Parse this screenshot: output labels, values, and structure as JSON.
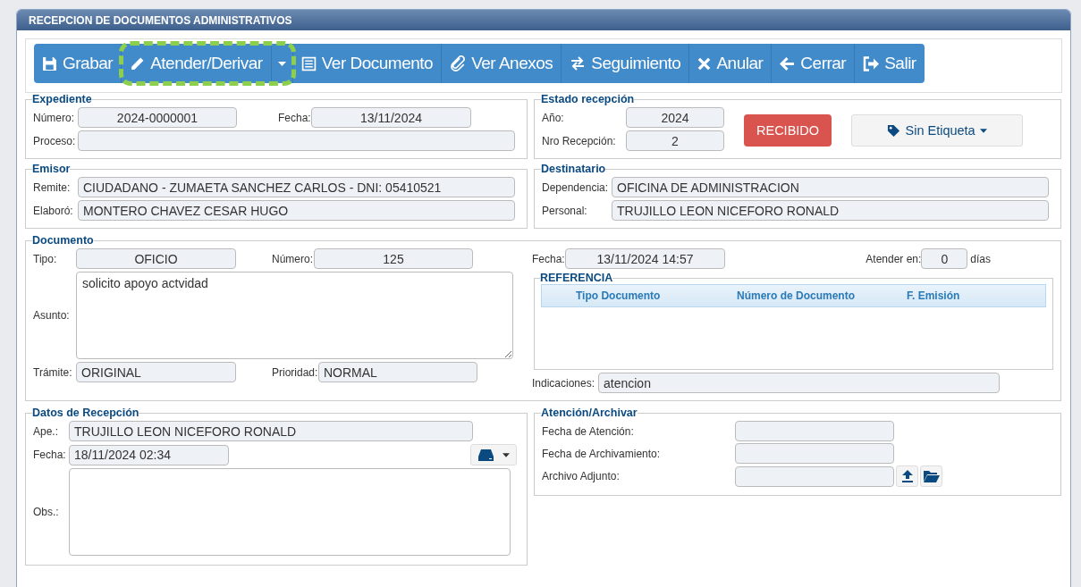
{
  "window": {
    "title": "RECEPCION DE DOCUMENTOS ADMINISTRATIVOS"
  },
  "toolbar": [
    {
      "kind": "button",
      "label": "Grabar",
      "highlighted": false
    },
    {
      "kind": "split",
      "label": "Atender/Derivar",
      "highlighted": true
    },
    {
      "kind": "button",
      "label": "Ver Documento",
      "highlighted": false
    },
    {
      "kind": "button",
      "label": "Ver Anexos",
      "highlighted": false
    },
    {
      "kind": "button",
      "label": "Seguimiento",
      "highlighted": false
    },
    {
      "kind": "button",
      "label": "Anular",
      "highlighted": false
    },
    {
      "kind": "button",
      "label": "Cerrar",
      "highlighted": false
    },
    {
      "kind": "button",
      "label": "Salir",
      "highlighted": false
    }
  ],
  "expediente": {
    "legend": "Expediente",
    "numero": {
      "label": "Número:",
      "value": "2024-0000001"
    },
    "fecha": {
      "label": "Fecha:",
      "value": "13/11/2024"
    },
    "proceso": {
      "label": "Proceso:"
    }
  },
  "estado": {
    "legend": "Estado recepción",
    "anio": {
      "label": "Año:",
      "value": "2024"
    },
    "nro": {
      "label": "Nro Recepción:",
      "value": "2"
    },
    "status": "RECIBIDO",
    "etiqueta": "Sin Etiqueta"
  },
  "emisor": {
    "legend": "Emisor",
    "remite": {
      "label": "Remite:",
      "value": "CIUDADANO - ZUMAETA SANCHEZ CARLOS - DNI: 05410521"
    },
    "elaboro": {
      "label": "Elaboró:",
      "value": "MONTERO CHAVEZ CESAR HUGO"
    }
  },
  "destinatario": {
    "legend": "Destinatario",
    "dependencia": {
      "label": "Dependencia:",
      "value": "OFICINA DE ADMINISTRACION"
    },
    "personal": {
      "label": "Personal:",
      "value": "TRUJILLO LEON NICEFORO RONALD"
    }
  },
  "documento": {
    "legend": "Documento",
    "tipo": {
      "label": "Tipo:",
      "value": "OFICIO"
    },
    "numero": {
      "label": "Número:",
      "value": "125"
    },
    "fecha": {
      "label": "Fecha:",
      "value": "13/11/2024 14:57"
    },
    "atender_en": {
      "label": "Atender en:",
      "value": "0",
      "unit": "días"
    },
    "asunto": {
      "label": "Asunto:",
      "value": "solicito apoyo actvidad"
    },
    "tramite": {
      "label": "Trámite:",
      "value": "ORIGINAL"
    },
    "prioridad": {
      "label": "Prioridad:",
      "value": "NORMAL"
    },
    "indicaciones": {
      "label": "Indicaciones:",
      "value": "atencion"
    },
    "referencia": {
      "legend": "REFERENCIA",
      "columns": [
        "Tipo Documento",
        "Número de Documento",
        "F. Emisión"
      ]
    }
  },
  "recepcion": {
    "legend": "Datos de Recepción",
    "ape": {
      "label": "Ape.:",
      "value": "TRUJILLO LEON NICEFORO RONALD"
    },
    "fecha": {
      "label": "Fecha:",
      "value": "18/11/2024 02:34"
    },
    "obs": {
      "label": "Obs.:"
    }
  },
  "atencion": {
    "legend": "Atención/Archivar",
    "fecha_atencion": {
      "label": "Fecha de Atención:"
    },
    "fecha_archivamiento": {
      "label": "Fecha de Archivamiento:"
    },
    "archivo": {
      "label": "Archivo Adjunto:"
    }
  }
}
